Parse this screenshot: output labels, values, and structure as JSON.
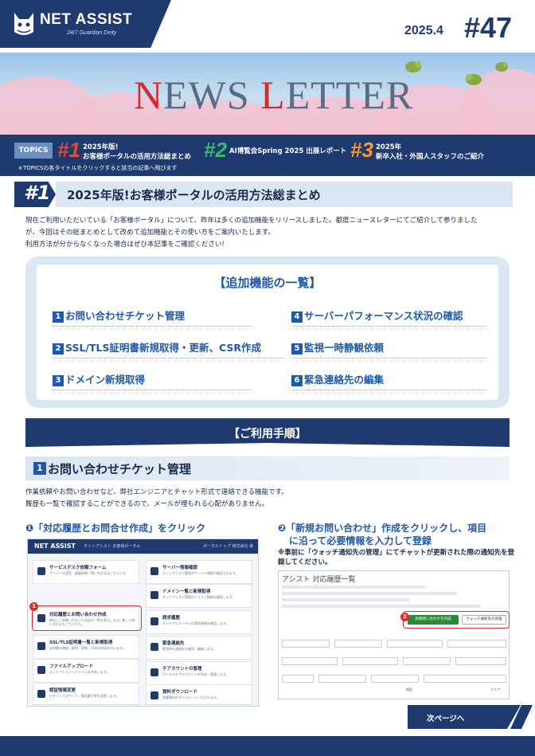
{
  "header": {
    "brand": "NET ASSIST",
    "tagline": "24/7 Guardian Deity",
    "date": "2025.4",
    "issue": "#47",
    "title_red_1": "N",
    "title_part_1": "EWS ",
    "title_red_2": "L",
    "title_part_2": "ETTER"
  },
  "topics": {
    "label": "TOPICS",
    "items": [
      {
        "num": "#1",
        "line1": "2025年版!",
        "line2": "お客様ポータルの活用方法総まとめ"
      },
      {
        "num": "#2",
        "line1": "AI博覧会Spring 2025 出展レポート",
        "line2": ""
      },
      {
        "num": "#3",
        "line1": "2025年",
        "line2": "新卒入社・外国人スタッフのご紹介"
      }
    ],
    "note": "＊TOPICSの各タイトルをクリックすると該当の記事へ飛びます"
  },
  "article": {
    "num": "#1",
    "title": "2025年版!お客様ポータルの活用方法総まとめ",
    "intro_1": "現在ご利用いただいている「お客様ポータル」について、昨年は多くの追加機能をリリースしました。都度ニュースレターにてご紹介して参りました",
    "intro_2": "が、今回はその総まとめとして改めて追加機能とその使い方をご案内いたします。",
    "intro_3": "利用方法が分からなくなった場合はぜひ本記事をご確認ください!"
  },
  "features": {
    "title": "【追加機能の一覧】",
    "items": [
      {
        "n": "1",
        "label": "お問い合わせチケット管理"
      },
      {
        "n": "2",
        "label": "SSL/TLS証明書新規取得・更新、CSR作成"
      },
      {
        "n": "3",
        "label": "ドメイン新規取得"
      },
      {
        "n": "4",
        "label": "サーバーパフォーマンス状況の確認"
      },
      {
        "n": "5",
        "label": "監視一時静観依頼"
      },
      {
        "n": "6",
        "label": "緊急連絡先の編集"
      }
    ]
  },
  "procedure": {
    "title": "【ご利用手順】",
    "sub_num": "1",
    "sub_title": "お問い合わせチケット管理",
    "desc_1": "作業依頼やお問い合わせなど、弊社エンジニアとチャット形式で連絡できる機能です。",
    "desc_2": "履歴も一覧で確認することができるので、メールが埋もれる心配がありません。",
    "step1": "❶「対応履歴とお問合せ作成」をクリック",
    "step2_1": "❷「新規お問い合わせ」作成をクリックし、項目",
    "step2_2": "に沿って必要情報を入力して登録",
    "step2_note": "※事前に「ウォッチ通知先の管理」にてチャットが更新された際の通知先を登録してください。"
  },
  "screen1": {
    "logo": "NET ASSIST",
    "top_text": "ネットアシスト お客様ポータル",
    "top_right": "ポータルトップ 株式会社 様",
    "cards": [
      {
        "t": "サービスデスク依頼フォーム",
        "d": "サーバーの設定・調査依頼、問い合わせはこちらです。"
      },
      {
        "t": "サーバー情報確認",
        "d": "ネットアシスト管理のサーバー情報が確認できます。"
      },
      {
        "t": "対応履歴とお問い合わせ作成",
        "d": "弊社にご依頼いただいた対応の一覧を表示します。新しい問い合わせもこちらから。"
      },
      {
        "t": "ドメイン一覧と新規取得",
        "d": "ネットアシスト管理のドメイン情報を確認します。"
      },
      {
        "t": "SSL/TLS証明書一覧と新規取得",
        "d": "証明書の確認・取得・更新、CSRの作成を行います。"
      },
      {
        "t": "請求履歴",
        "d": "ネットアシストからの請求情報を確認します。"
      },
      {
        "t": "ファイルアップロード",
        "d": "ネットアシストへファイルを共有します。"
      },
      {
        "t": "緊急連絡先",
        "d": "緊急時の連絡先を確認・編集します。"
      },
      {
        "t": "認証情報変更",
        "d": "ログインパスワード、電話番号等を変更します。"
      },
      {
        "t": "子アカウントの管理",
        "d": "ポータルの子アカウントを作成・管理します。"
      },
      {
        "t": "資料ダウンロード",
        "d": "各種資料をダウンロードいただけます。"
      }
    ]
  },
  "screen2": {
    "title": "アシスト 対応履歴一覧",
    "btn_new": "新規問い合わせを作成",
    "btn_watch": "ウォッチ通知先の管理",
    "search": "検索",
    "clear": "クリア"
  },
  "next": "次ページへ"
}
